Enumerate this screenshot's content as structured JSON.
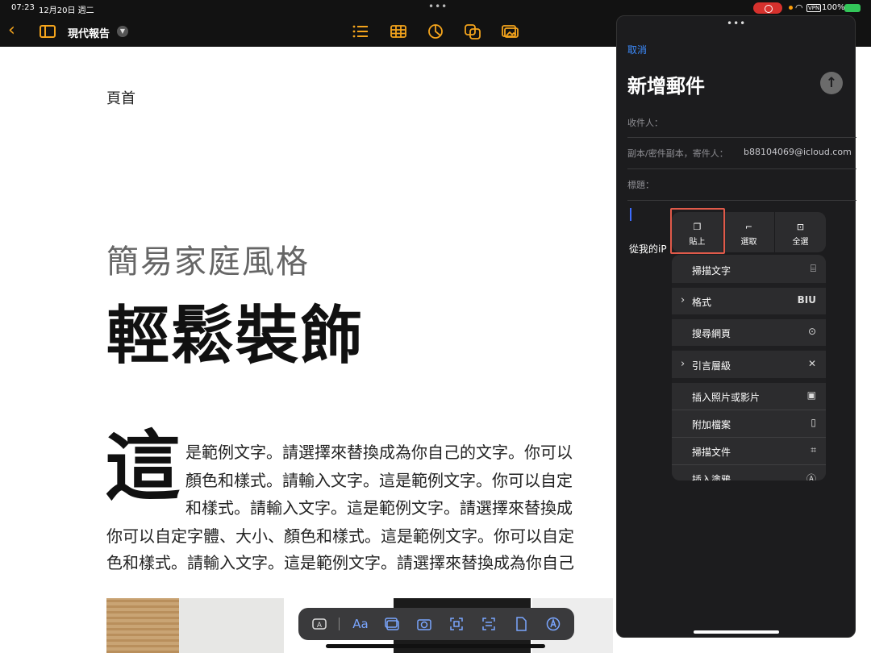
{
  "status_bar": {
    "time": "07:23",
    "date": "12月20日 週二",
    "vpn": "VPN",
    "battery": "100%"
  },
  "toolbar": {
    "back_icon": "chevron-left-icon",
    "sidebar_icon": "sidebar-icon",
    "doc_title": "現代報告",
    "icons": [
      "list-icon",
      "table-icon",
      "chart-icon",
      "shapes-icon",
      "media-icon"
    ],
    "accent": "#f4a41c"
  },
  "document": {
    "header": "頁首",
    "subtitle": "簡易家庭風格",
    "title": "輕鬆裝飾",
    "dropcap": "這",
    "lines": [
      "是範例文字。請選擇來替換成為你自己的文字。你可以",
      "顏色和樣式。請輸入文字。這是範例文字。你可以自定",
      "和樣式。請輸入文字。這是範例文字。請選擇來替換成",
      "你可以自定字體、大小、顏色和樣式。這是範例文字。你可以自定",
      "色和樣式。請輸入文字。這是範例文字。請選擇來替換成為你自己"
    ]
  },
  "bottom_bar": {
    "icons": [
      "text-box-icon",
      "font-icon",
      "photo-icon",
      "camera-icon",
      "scan-icon",
      "scan-text-icon",
      "document-icon",
      "markup-icon"
    ],
    "font_label": "Aa"
  },
  "mail": {
    "cancel": "取消",
    "heading": "新增郵件",
    "to_label": "收件人：",
    "cc_label": "副本/密件副本，寄件人：",
    "cc_value": "b88104069@icloud.com",
    "subject_label": "標題：",
    "signature": "從我的iP",
    "accent": "#3d8cff"
  },
  "context_menu": {
    "top_actions": [
      {
        "label": "貼上",
        "icon": "paste-icon"
      },
      {
        "label": "選取",
        "icon": "select-icon"
      },
      {
        "label": "全選",
        "icon": "select-all-icon"
      }
    ],
    "items": [
      {
        "label": "掃描文字",
        "icon": "scan-text-icon",
        "submenu": false
      },
      {
        "label": "格式",
        "icon": "biu-icon",
        "submenu": true
      },
      {
        "label": "搜尋網頁",
        "icon": "search-icon",
        "submenu": false
      },
      {
        "label": "引言層級",
        "icon": "close-icon",
        "submenu": true
      },
      {
        "label": "插入照片或影片",
        "icon": "photo-icon",
        "submenu": false
      },
      {
        "label": "附加檔案",
        "icon": "document-icon",
        "submenu": false
      },
      {
        "label": "掃描文件",
        "icon": "scan-document-icon",
        "submenu": false
      },
      {
        "label": "插入塗鴉",
        "icon": "markup-icon",
        "submenu": false
      }
    ],
    "format_glyph": "BIU",
    "highlight_color": "#e05a4a"
  }
}
